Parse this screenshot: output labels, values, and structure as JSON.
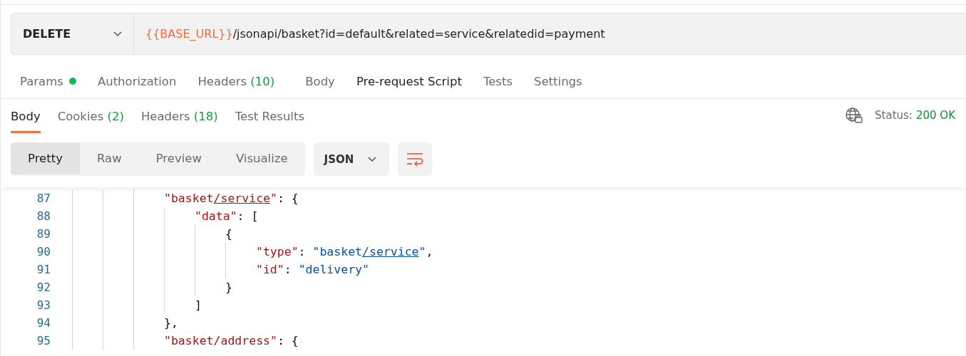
{
  "request": {
    "method": "DELETE",
    "url_variable": "{{BASE_URL}}",
    "url_path": "/jsonapi/basket?id=default&related=service&relatedid=payment"
  },
  "request_tabs": [
    {
      "label": "Params",
      "dot": true,
      "selected": false
    },
    {
      "label": "Authorization",
      "dot": false,
      "selected": false
    },
    {
      "label": "Headers",
      "count": "(10)",
      "dot": false,
      "selected": false
    },
    {
      "label": "Body",
      "dot": false,
      "selected": false
    },
    {
      "label": "Pre-request Script",
      "dot": false,
      "selected": true
    },
    {
      "label": "Tests",
      "dot": false,
      "selected": false
    },
    {
      "label": "Settings",
      "dot": false,
      "selected": false
    }
  ],
  "response_tabs": [
    {
      "label": "Body",
      "selected": true
    },
    {
      "label": "Cookies",
      "count": "(2)",
      "selected": false
    },
    {
      "label": "Headers",
      "count": "(18)",
      "selected": false
    },
    {
      "label": "Test Results",
      "selected": false
    }
  ],
  "status": {
    "label": "Status:",
    "value": "200 OK"
  },
  "view_modes": [
    {
      "label": "Pretty",
      "selected": true
    },
    {
      "label": "Raw",
      "selected": false
    },
    {
      "label": "Preview",
      "selected": false
    },
    {
      "label": "Visualize",
      "selected": false
    }
  ],
  "format": "JSON",
  "code_lines": [
    {
      "number": "87",
      "tokens": [
        {
          "kind": "key",
          "text": "\"basket"
        },
        {
          "kind": "key-link",
          "text": "/service"
        },
        {
          "kind": "key",
          "text": "\""
        },
        {
          "kind": "punct",
          "text": ": {"
        }
      ],
      "children": [
        {
          "number": "88",
          "tokens": [
            {
              "kind": "key",
              "text": "\"data\""
            },
            {
              "kind": "punct",
              "text": ": ["
            }
          ],
          "children": [
            {
              "number": "89",
              "tokens": [
                {
                  "kind": "punct",
                  "text": "{"
                }
              ],
              "children": [
                {
                  "number": "90",
                  "tokens": [
                    {
                      "kind": "key",
                      "text": "\"type\""
                    },
                    {
                      "kind": "punct",
                      "text": ": "
                    },
                    {
                      "kind": "string",
                      "text": "\"basket"
                    },
                    {
                      "kind": "string-link",
                      "text": "/service"
                    },
                    {
                      "kind": "string",
                      "text": "\""
                    },
                    {
                      "kind": "punct",
                      "text": ","
                    }
                  ]
                },
                {
                  "number": "91",
                  "tokens": [
                    {
                      "kind": "key",
                      "text": "\"id\""
                    },
                    {
                      "kind": "punct",
                      "text": ": "
                    },
                    {
                      "kind": "string",
                      "text": "\"delivery\""
                    }
                  ]
                }
              ]
            },
            {
              "number": "92",
              "tokens": [
                {
                  "kind": "punct",
                  "text": "}"
                }
              ]
            }
          ]
        },
        {
          "number": "93",
          "tokens": [
            {
              "kind": "punct",
              "text": "]"
            }
          ]
        }
      ]
    },
    {
      "number": "94",
      "tokens": [
        {
          "kind": "punct",
          "text": "},"
        }
      ]
    },
    {
      "number": "95",
      "tokens": [
        {
          "kind": "key",
          "text": "\"basket/address\""
        },
        {
          "kind": "punct",
          "text": ": {"
        }
      ]
    }
  ]
}
